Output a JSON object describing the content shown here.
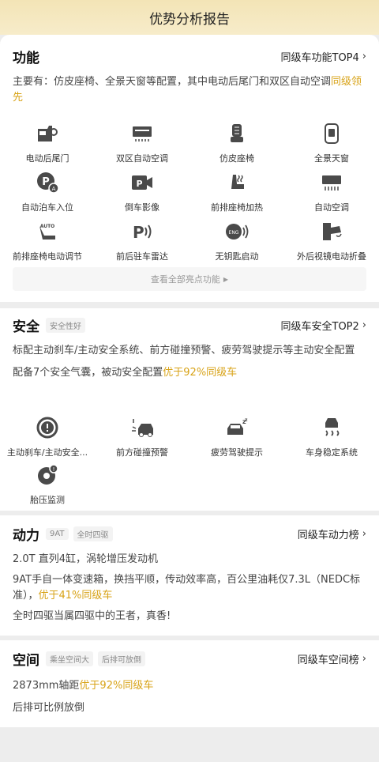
{
  "header": {
    "title": "优势分析报告"
  },
  "function": {
    "title": "功能",
    "rank": "同级车功能TOP4",
    "desc_normal": "主要有：仿皮座椅、全景天窗等配置，其中电动后尾门和双区自动空调",
    "desc_highlight": "同级领先",
    "items": [
      {
        "label": "电动后尾门",
        "icon": "tailgate-icon"
      },
      {
        "label": "双区自动空调",
        "icon": "dual-ac-icon"
      },
      {
        "label": "仿皮座椅",
        "icon": "leather-seat-icon"
      },
      {
        "label": "全景天窗",
        "icon": "sunroof-icon"
      },
      {
        "label": "自动泊车入位",
        "icon": "auto-park-icon"
      },
      {
        "label": "倒车影像",
        "icon": "reverse-camera-icon"
      },
      {
        "label": "前排座椅加热",
        "icon": "seat-heat-icon"
      },
      {
        "label": "自动空调",
        "icon": "auto-ac-icon"
      },
      {
        "label": "前排座椅电动调节",
        "icon": "seat-adjust-icon"
      },
      {
        "label": "前后驻车雷达",
        "icon": "parking-radar-icon"
      },
      {
        "label": "无钥匙启动",
        "icon": "keyless-start-icon"
      },
      {
        "label": "外后视镜电动折叠",
        "icon": "mirror-fold-icon"
      }
    ],
    "more_label": "查看全部亮点功能"
  },
  "safety": {
    "title": "安全",
    "tag": "安全性好",
    "rank": "同级车安全TOP2",
    "desc1": "标配主动刹车/主动安全系统、前方碰撞预警、疲劳驾驶提示等主动安全配置",
    "desc2_normal": "配备7个安全气囊，被动安全配置",
    "desc2_highlight": "优于92%同级车",
    "items": [
      {
        "label": "主动刹车/主动安全...",
        "icon": "active-brake-icon"
      },
      {
        "label": "前方碰撞预警",
        "icon": "collision-warning-icon"
      },
      {
        "label": "疲劳驾驶提示",
        "icon": "fatigue-icon"
      },
      {
        "label": "车身稳定系统",
        "icon": "stability-icon"
      },
      {
        "label": "胎压监测",
        "icon": "tire-pressure-icon"
      }
    ]
  },
  "power": {
    "title": "动力",
    "tags": [
      "9AT",
      "全时四驱"
    ],
    "rank": "同级车动力榜",
    "line1": "2.0T 直列4缸，涡轮增压发动机",
    "line2_normal": "9AT手自一体变速箱，换挡平顺，传动效率高，百公里油耗仅7.3L（NEDC标准），",
    "line2_highlight": "优于41%同级车",
    "line3": "全时四驱当属四驱中的王者，真香!"
  },
  "space": {
    "title": "空间",
    "tags": [
      "乘坐空间大",
      "后排可放倒"
    ],
    "rank": "同级车空间榜",
    "line1_normal": "2873mm轴距",
    "line1_highlight": "优于92%同级车",
    "line2": "后排可比例放倒"
  },
  "colors": {
    "accent": "#d8a318",
    "header_bg": "#f5e8c0",
    "icon": "#4a4a4a"
  }
}
